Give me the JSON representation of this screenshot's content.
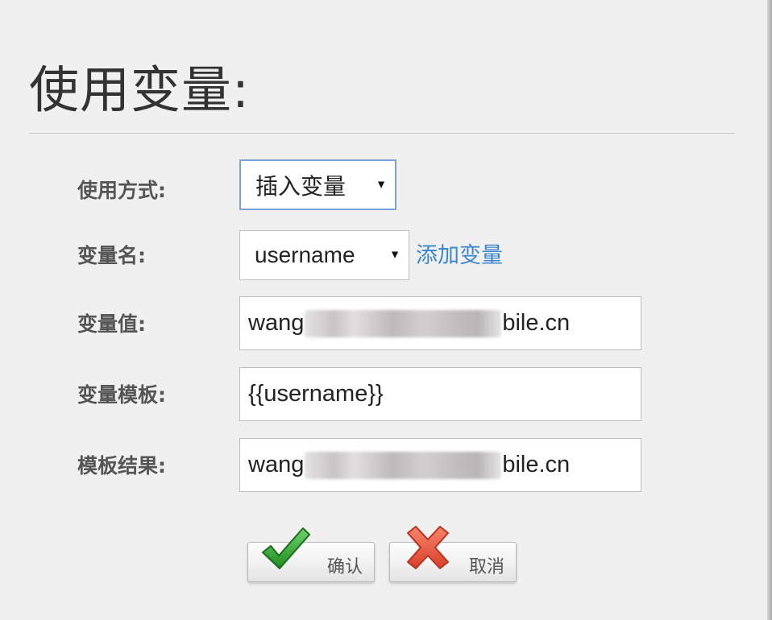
{
  "dialog": {
    "title": "使用变量:"
  },
  "form": {
    "usage_mode": {
      "label": "使用方式:",
      "value": "插入变量"
    },
    "variable_name": {
      "label": "变量名:",
      "value": "username",
      "add_link": "添加变量"
    },
    "variable_value": {
      "label": "变量值:",
      "prefix": "wang",
      "suffix": "bile.cn"
    },
    "variable_template": {
      "label": "变量模板:",
      "value": "{{username}}"
    },
    "template_result": {
      "label": "模板结果:",
      "prefix": "wang",
      "suffix": "bile.cn"
    }
  },
  "buttons": {
    "confirm": {
      "label": "确认",
      "icon": "checkmark-icon",
      "color": "#2e9b2e"
    },
    "cancel": {
      "label": "取消",
      "icon": "cross-icon",
      "color": "#e2553f"
    }
  },
  "colors": {
    "link": "#3b86cf",
    "background": "#f0f0f0",
    "focus_border": "#7da2d8"
  }
}
